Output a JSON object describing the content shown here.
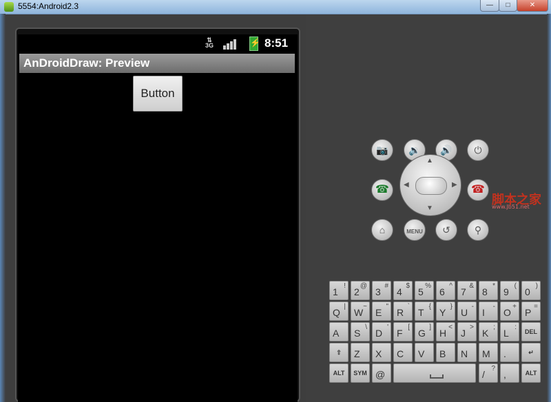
{
  "window": {
    "title": "5554:Android2.3",
    "minimize_label": "—",
    "maximize_label": "□",
    "close_label": "✕"
  },
  "status_bar": {
    "network": "3G",
    "clock": "8:51"
  },
  "app": {
    "title": "AnDroidDraw: Preview",
    "button_label": "Button"
  },
  "hardware_buttons": {
    "camera": "📷",
    "volume_down": "🔉",
    "volume_up": "🔊",
    "power": "⏻",
    "call": "☎",
    "end_call": "☎",
    "home": "⌂",
    "menu": "MENU",
    "back": "↺",
    "search": "⚲"
  },
  "keyboard": {
    "row1": [
      [
        "1",
        "!"
      ],
      [
        "2",
        "@"
      ],
      [
        "3",
        "#"
      ],
      [
        "4",
        "$"
      ],
      [
        "5",
        "%"
      ],
      [
        "6",
        "^"
      ],
      [
        "7",
        "&"
      ],
      [
        "8",
        "*"
      ],
      [
        "9",
        "("
      ],
      [
        "0",
        ")"
      ]
    ],
    "row2": [
      [
        "Q",
        "|"
      ],
      [
        "W",
        "~"
      ],
      [
        "E",
        "\""
      ],
      [
        "R",
        "`"
      ],
      [
        "T",
        "{"
      ],
      [
        "Y",
        "}"
      ],
      [
        "U",
        "-"
      ],
      [
        "I",
        "-"
      ],
      [
        "O",
        "+"
      ],
      [
        "P",
        "="
      ]
    ],
    "row3": [
      [
        "A",
        ""
      ],
      [
        "S",
        "\\"
      ],
      [
        "D",
        "'"
      ],
      [
        "F",
        "["
      ],
      [
        "G",
        "]"
      ],
      [
        "H",
        "<"
      ],
      [
        "J",
        ">"
      ],
      [
        "K",
        ";"
      ],
      [
        "L",
        ":"
      ]
    ],
    "row4": [
      [
        "Z",
        ""
      ],
      [
        "X",
        ""
      ],
      [
        "C",
        ""
      ],
      [
        "V",
        ""
      ],
      [
        "B",
        ""
      ],
      [
        "N",
        ""
      ],
      [
        "M",
        ""
      ],
      [
        ".",
        ""
      ]
    ],
    "del": "DEL",
    "enter": "↵",
    "shift": "⇧",
    "alt_left": "ALT",
    "sym": "SYM",
    "at": "@",
    "slash": "/",
    "question": "?",
    "comma": ",",
    "alt_right": "ALT"
  },
  "watermark": {
    "text": "脚本之家",
    "url": "www.Jb51.net"
  }
}
